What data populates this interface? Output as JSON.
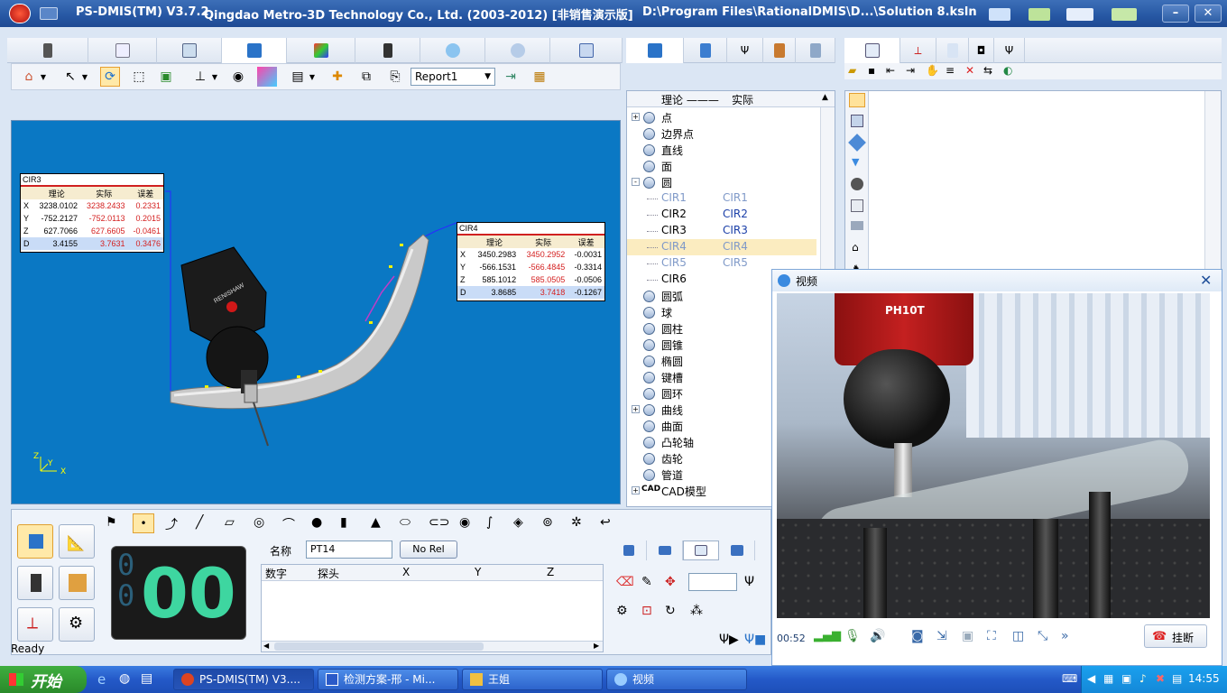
{
  "window": {
    "app_title": "PS-DMIS(TM) V3.7.2",
    "company": "Qingdao Metro-3D Technology Co., Ltd. (2003-2012) [非销售演示版]",
    "file_path": "D:\\Program Files\\RationalDMIS\\D...\\Solution 8.ksln"
  },
  "toolbar": {
    "report_select": "Report1"
  },
  "cir3_panel": {
    "title": "CIR3",
    "headers": [
      "理论",
      "实际",
      "误差"
    ],
    "rows": [
      {
        "axis": "X",
        "nominal": "3238.0102",
        "actual": "3238.2433",
        "error": "0.2331"
      },
      {
        "axis": "Y",
        "nominal": "-752.2127",
        "actual": "-752.0113",
        "error": "0.2015"
      },
      {
        "axis": "Z",
        "nominal": "627.7066",
        "actual": "627.6605",
        "error": "-0.0461"
      },
      {
        "axis": "D",
        "nominal": "3.4155",
        "actual": "3.7631",
        "error": "0.3476"
      }
    ]
  },
  "cir4_panel": {
    "title": "CIR4",
    "headers": [
      "理论",
      "实际",
      "误差"
    ],
    "rows": [
      {
        "axis": "X",
        "nominal": "3450.2983",
        "actual": "3450.2952",
        "error": "-0.0031"
      },
      {
        "axis": "Y",
        "nominal": "-566.1531",
        "actual": "-566.4845",
        "error": "-0.3314"
      },
      {
        "axis": "Z",
        "nominal": "585.1012",
        "actual": "585.0505",
        "error": "-0.0506"
      },
      {
        "axis": "D",
        "nominal": "3.8685",
        "actual": "3.7418",
        "error": "-0.1267"
      }
    ]
  },
  "probe_brand": "RENISHAW",
  "axes_labels": {
    "z": "Z",
    "y": "Y",
    "x": "X"
  },
  "tree": {
    "header_nominal": "理论 ———",
    "header_actual": "实际",
    "items": [
      {
        "label": "点",
        "expand": "+"
      },
      {
        "label": "边界点"
      },
      {
        "label": "直线"
      },
      {
        "label": "面"
      },
      {
        "label": "圆",
        "expand": "-"
      },
      {
        "label": "CIR1",
        "actual": "CIR1",
        "dim": true
      },
      {
        "label": "CIR2",
        "actual": "CIR2"
      },
      {
        "label": "CIR3",
        "actual": "CIR3"
      },
      {
        "label": "CIR4",
        "actual": "CIR4",
        "dim": true,
        "selected": true
      },
      {
        "label": "CIR5",
        "actual": "CIR5",
        "dim": true
      },
      {
        "label": "CIR6"
      },
      {
        "label": "圆弧"
      },
      {
        "label": "球"
      },
      {
        "label": "圆柱"
      },
      {
        "label": "圆锥"
      },
      {
        "label": "椭圆"
      },
      {
        "label": "键槽"
      },
      {
        "label": "圆环"
      },
      {
        "label": "曲线",
        "expand": "+"
      },
      {
        "label": "曲面"
      },
      {
        "label": "凸轮轴"
      },
      {
        "label": "齿轮"
      },
      {
        "label": "管道"
      },
      {
        "label": "CAD模型",
        "expand": "+",
        "icon_text": "CAD"
      }
    ]
  },
  "bottom": {
    "counter_small": "0",
    "counter_big": "00",
    "name_label": "名称",
    "name_value": "PT14",
    "norel_button": "No Rel",
    "columns": [
      "数字",
      "探头",
      "X",
      "Y",
      "Z"
    ]
  },
  "video": {
    "title": "视频",
    "probe_label": "PH10T",
    "timer": "00:52",
    "hangup": "挂断",
    "more": "»"
  },
  "status": {
    "text": "Ready"
  },
  "taskbar": {
    "start": "开始",
    "tasks": [
      "PS-DMIS(TM) V3....",
      "检测方案-邢 - Mi...",
      "王姐",
      "视频"
    ],
    "clock": "14:55"
  },
  "colors": {
    "viewport_bg": "#0a78c4",
    "title_bar": "#2657a3",
    "counter_green": "#3ed6a0"
  }
}
